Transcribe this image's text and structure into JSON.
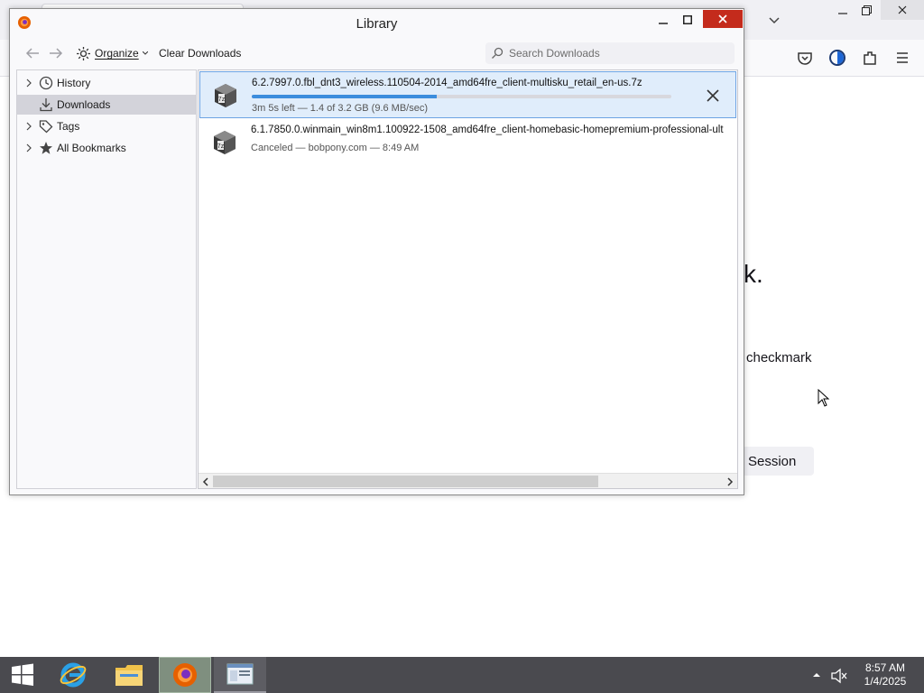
{
  "background": {
    "content_fragments": {
      "period_fragment": "k.",
      "checkmark_fragment": "checkmark",
      "session_button": "Session"
    }
  },
  "library": {
    "title": "Library",
    "toolbar": {
      "organize_label": "Organize",
      "clear_downloads_label": "Clear Downloads",
      "search_placeholder": "Search Downloads"
    },
    "sidebar": {
      "items": [
        {
          "label": "History",
          "icon": "clock-icon",
          "expandable": true
        },
        {
          "label": "Downloads",
          "icon": "download-icon",
          "expandable": false,
          "selected": true
        },
        {
          "label": "Tags",
          "icon": "tag-icon",
          "expandable": true
        },
        {
          "label": "All Bookmarks",
          "icon": "star-icon",
          "expandable": true
        }
      ]
    },
    "downloads": [
      {
        "filename": "6.2.7997.0.fbl_dnt3_wireless.110504-2014_amd64fre_client-multisku_retail_en-us.7z",
        "status": "3m 5s left — 1.4 of 3.2 GB (9.6 MB/sec)",
        "progress_fraction": 0.44,
        "in_progress": true
      },
      {
        "filename": "6.1.7850.0.winmain_win8m1.100922-1508_amd64fre_client-homebasic-homepremium-professional-ult",
        "status": "Canceled — bobpony.com — 8:49 AM",
        "in_progress": false
      }
    ]
  },
  "taskbar": {
    "apps": [
      "start-icon",
      "internet-explorer-icon",
      "file-explorer-icon",
      "firefox-icon",
      "library-window-icon"
    ],
    "clock_time": "8:57 AM",
    "clock_date": "1/4/2025"
  },
  "colors": {
    "accent_progress": "#3c8ddd",
    "close_button": "#c42b1c",
    "taskbar": "#4a4a4f"
  }
}
